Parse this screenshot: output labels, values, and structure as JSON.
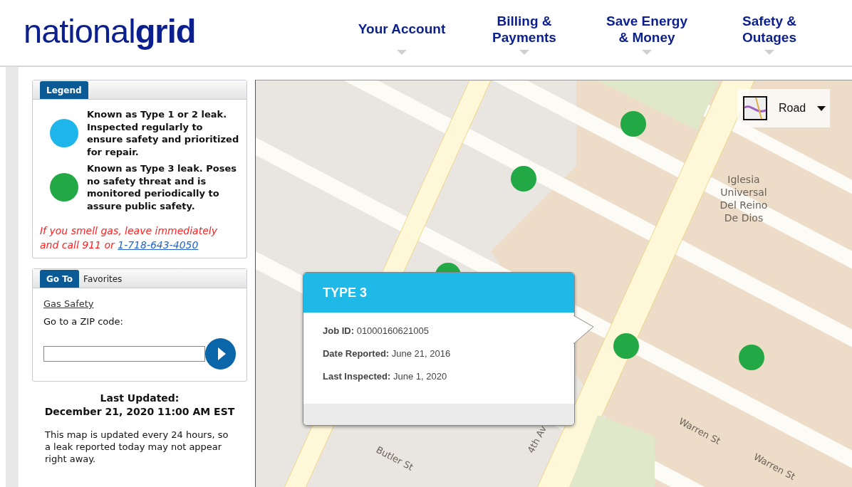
{
  "logo": {
    "light": "national",
    "bold": "grid"
  },
  "nav": [
    {
      "label": "Your Account"
    },
    {
      "label": "Billing & Payments"
    },
    {
      "label": "Save Energy & Money"
    },
    {
      "label": "Safety & Outages"
    }
  ],
  "legend": {
    "tab": "Legend",
    "items": [
      {
        "color": "#1eb6ea",
        "text": "Known as Type 1 or 2 leak. Inspected regularly to ensure safety and prioritized for repair."
      },
      {
        "color": "#22a845",
        "text": "Known as Type 3 leak. Poses no safety threat and is monitored periodically to assure public safety."
      }
    ],
    "warning": "If you smell gas, leave immediately and call 911 or",
    "phone": "1-718-643-4050"
  },
  "goto": {
    "tabs": [
      {
        "label": "Go To",
        "selected": true
      },
      {
        "label": "Favorites",
        "selected": false
      }
    ],
    "link": "Gas Safety",
    "zip_label": "Go to a ZIP code:"
  },
  "updated": {
    "title": "Last Updated:",
    "date": "December 21, 2020 11:00 AM EST",
    "note": "This map is updated every 24 hours, so a leak reported today may not appear right away."
  },
  "map": {
    "style_label": "Road",
    "labels": [
      {
        "kind": "place",
        "text": "Iglesia Universal Del Reino De Dios"
      },
      {
        "kind": "street",
        "text": "Warren St"
      },
      {
        "kind": "street",
        "text": "Warren St"
      },
      {
        "kind": "street",
        "text": "Butler St"
      },
      {
        "kind": "street",
        "text": "4th Av"
      }
    ],
    "pins": [
      {
        "color": "#22a845"
      },
      {
        "color": "#22a845"
      },
      {
        "color": "#22a845"
      },
      {
        "color": "#22a845"
      },
      {
        "color": "#22a845"
      }
    ],
    "popup": {
      "title": "TYPE 3",
      "fields": [
        {
          "label": "Job ID:",
          "value": "01000160621005"
        },
        {
          "label": "Date Reported:",
          "value": "June 21, 2016"
        },
        {
          "label": "Last Inspected:",
          "value": "June 1, 2020"
        }
      ]
    }
  }
}
